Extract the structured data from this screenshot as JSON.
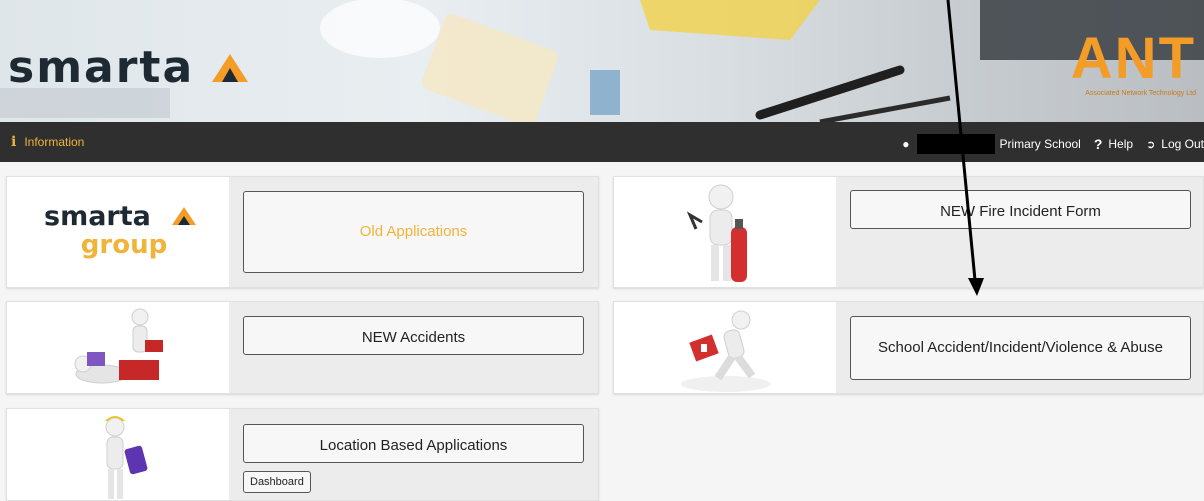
{
  "banner": {
    "logo_text": "smarta",
    "partner_logo_text": "ANT",
    "partner_logo_subtext": "Associated Network Technology Ltd",
    "colors": {
      "brand_orange": "#f39c28",
      "brand_dark": "#1e2a33"
    }
  },
  "navbar": {
    "info_icon": "info-icon",
    "info_label": "Information",
    "user_icon": "user-icon",
    "user_name_redacted": "",
    "school_name": "Primary School",
    "help_icon": "question-icon",
    "help_label": "Help",
    "logout_icon": "logout-icon",
    "logout_label": "Log Out",
    "colors": {
      "bar": "#2f2f2f",
      "accent": "#f0b43a"
    }
  },
  "cards": [
    {
      "image": "smarta-group-logo",
      "logo_text": "smarta",
      "logo_subtext": "group",
      "button_label": "Old Applications"
    },
    {
      "image": "fire-extinguisher-figure",
      "button_label": "NEW Fire Incident Form"
    },
    {
      "image": "accident-figures",
      "button_label": "NEW Accidents"
    },
    {
      "image": "running-first-aid-figure",
      "button_label": "School Accident/Incident/Violence & Abuse"
    },
    {
      "image": "tablet-worker-figure",
      "button_label": "Location Based Applications",
      "secondary_button_label": "Dashboard"
    }
  ]
}
